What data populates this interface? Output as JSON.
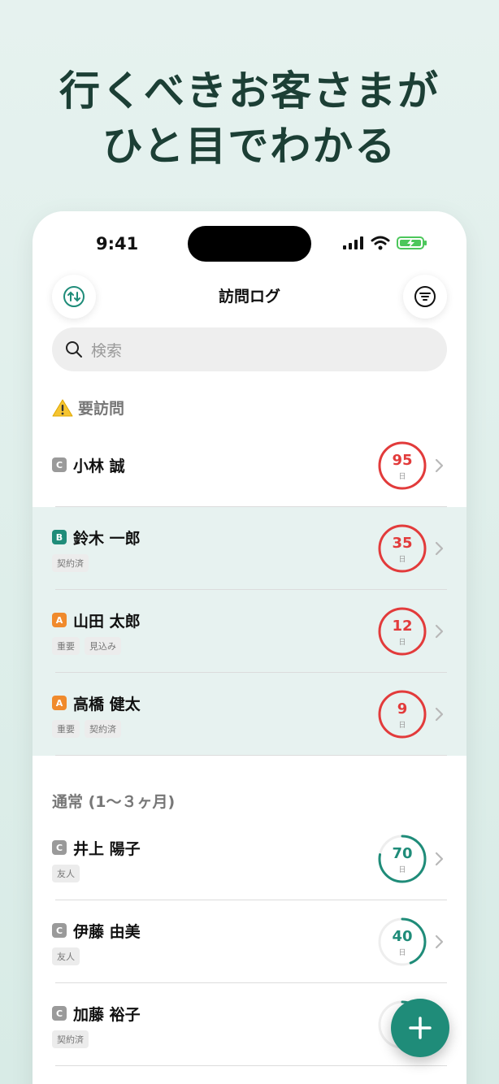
{
  "headline": {
    "line1": "行くべきお客さまが",
    "line2": "ひと目でわかる"
  },
  "status": {
    "time": "9:41"
  },
  "nav": {
    "title": "訪問ログ",
    "left_icon": "sort-arrows-icon",
    "right_icon": "filter-icon"
  },
  "search": {
    "placeholder": "検索"
  },
  "colors": {
    "accent": "#1f8c79",
    "alert": "#e23b3b",
    "highlight": "#e7f2f0",
    "rank_a": "#f08a2c",
    "rank_b": "#1f8c79",
    "rank_c": "#9a9a9a"
  },
  "sections": [
    {
      "title": "要訪問",
      "icon": "warning-icon",
      "rows": [
        {
          "rank": "C",
          "name": "小林 誠",
          "tags": [],
          "days": "95",
          "unit": "日",
          "progress": 1.0,
          "status": "alert"
        },
        {
          "rank": "B",
          "name": "鈴木 一郎",
          "tags": [
            "契約済"
          ],
          "days": "35",
          "unit": "日",
          "progress": 1.0,
          "status": "alert"
        },
        {
          "rank": "A",
          "name": "山田 太郎",
          "tags": [
            "重要",
            "見込み"
          ],
          "days": "12",
          "unit": "日",
          "progress": 1.0,
          "status": "alert"
        },
        {
          "rank": "A",
          "name": "高橋 健太",
          "tags": [
            "重要",
            "契約済"
          ],
          "days": "9",
          "unit": "日",
          "progress": 1.0,
          "status": "alert"
        }
      ]
    },
    {
      "title": "通常 (1〜３ヶ月)",
      "rows": [
        {
          "rank": "C",
          "name": "井上 陽子",
          "tags": [
            "友人"
          ],
          "days": "70",
          "unit": "日",
          "progress": 0.78,
          "status": "normal"
        },
        {
          "rank": "C",
          "name": "伊藤 由美",
          "tags": [
            "友人"
          ],
          "days": "40",
          "unit": "日",
          "progress": 0.44,
          "status": "normal"
        },
        {
          "rank": "C",
          "name": "加藤 裕子",
          "tags": [
            "契約済"
          ],
          "days": "",
          "unit": "",
          "progress": 0.1,
          "status": "normal"
        }
      ]
    }
  ],
  "fab": {
    "icon": "plus-icon"
  }
}
